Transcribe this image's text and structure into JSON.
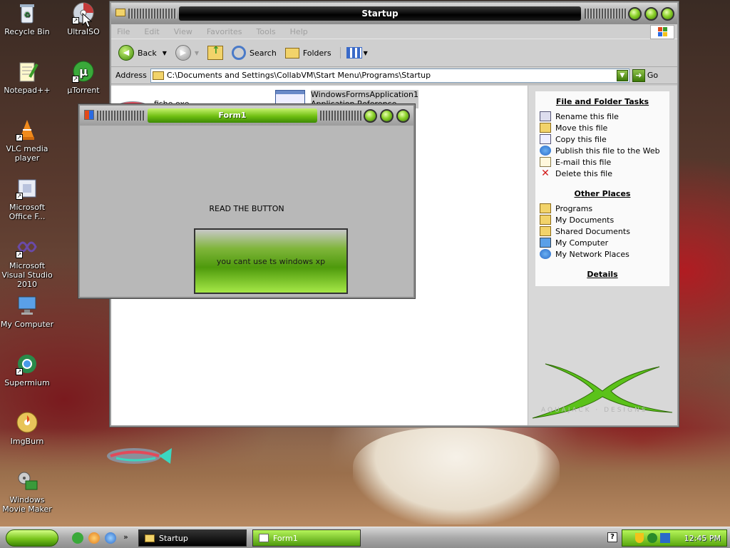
{
  "desktop_icons": [
    {
      "label": "Recycle Bin",
      "icon": "recycle-bin-icon"
    },
    {
      "label": "UltraISO",
      "icon": "disc-icon"
    },
    {
      "label": "Notepad++",
      "icon": "notepad-icon"
    },
    {
      "label": "µTorrent",
      "icon": "utorrent-icon"
    },
    {
      "label": "VLC media player",
      "icon": "vlc-icon"
    },
    {
      "label": "Microsoft Office F...",
      "icon": "office-icon"
    },
    {
      "label": "Microsoft Visual Studio 2010",
      "icon": "visual-studio-icon"
    },
    {
      "label": "My Computer",
      "icon": "computer-icon"
    },
    {
      "label": "Supermium",
      "icon": "browser-icon"
    },
    {
      "label": "ImgBurn",
      "icon": "imgburn-icon"
    },
    {
      "label": "Windows Movie Maker",
      "icon": "movie-maker-icon"
    }
  ],
  "explorer": {
    "title": "Startup",
    "menu": [
      "File",
      "Edit",
      "View",
      "Favorites",
      "Tools",
      "Help"
    ],
    "toolbar": {
      "back": "Back",
      "search": "Search",
      "folders": "Folders"
    },
    "address_label": "Address",
    "address_value": "C:\\Documents and Settings\\CollabVM\\Start Menu\\Programs\\Startup",
    "go_label": "Go",
    "files": [
      {
        "name": "fishe.exe"
      },
      {
        "name": "WindowsFormsApplication1",
        "subtitle": "Application Reference"
      }
    ],
    "file_tasks": {
      "title": "File and Folder Tasks",
      "items": [
        "Rename this file",
        "Move this file",
        "Copy this file",
        "Publish this file to the Web",
        "E-mail this file",
        "Delete this file"
      ]
    },
    "other_places": {
      "title": "Other Places",
      "items": [
        "Programs",
        "My Documents",
        "Shared Documents",
        "My Computer",
        "My Network Places"
      ]
    },
    "details_title": "Details",
    "watermark": "AQUAJACK · DESIGNS"
  },
  "form1": {
    "title": "Form1",
    "label": "READ THE BUTTON",
    "button": "you cant use ts windows xp"
  },
  "taskbar": {
    "tasks": [
      "Startup",
      "Form1"
    ],
    "time": "12:45 PM"
  },
  "colors": {
    "accent_green": "#6fbf12",
    "title_dark": "#000000"
  }
}
